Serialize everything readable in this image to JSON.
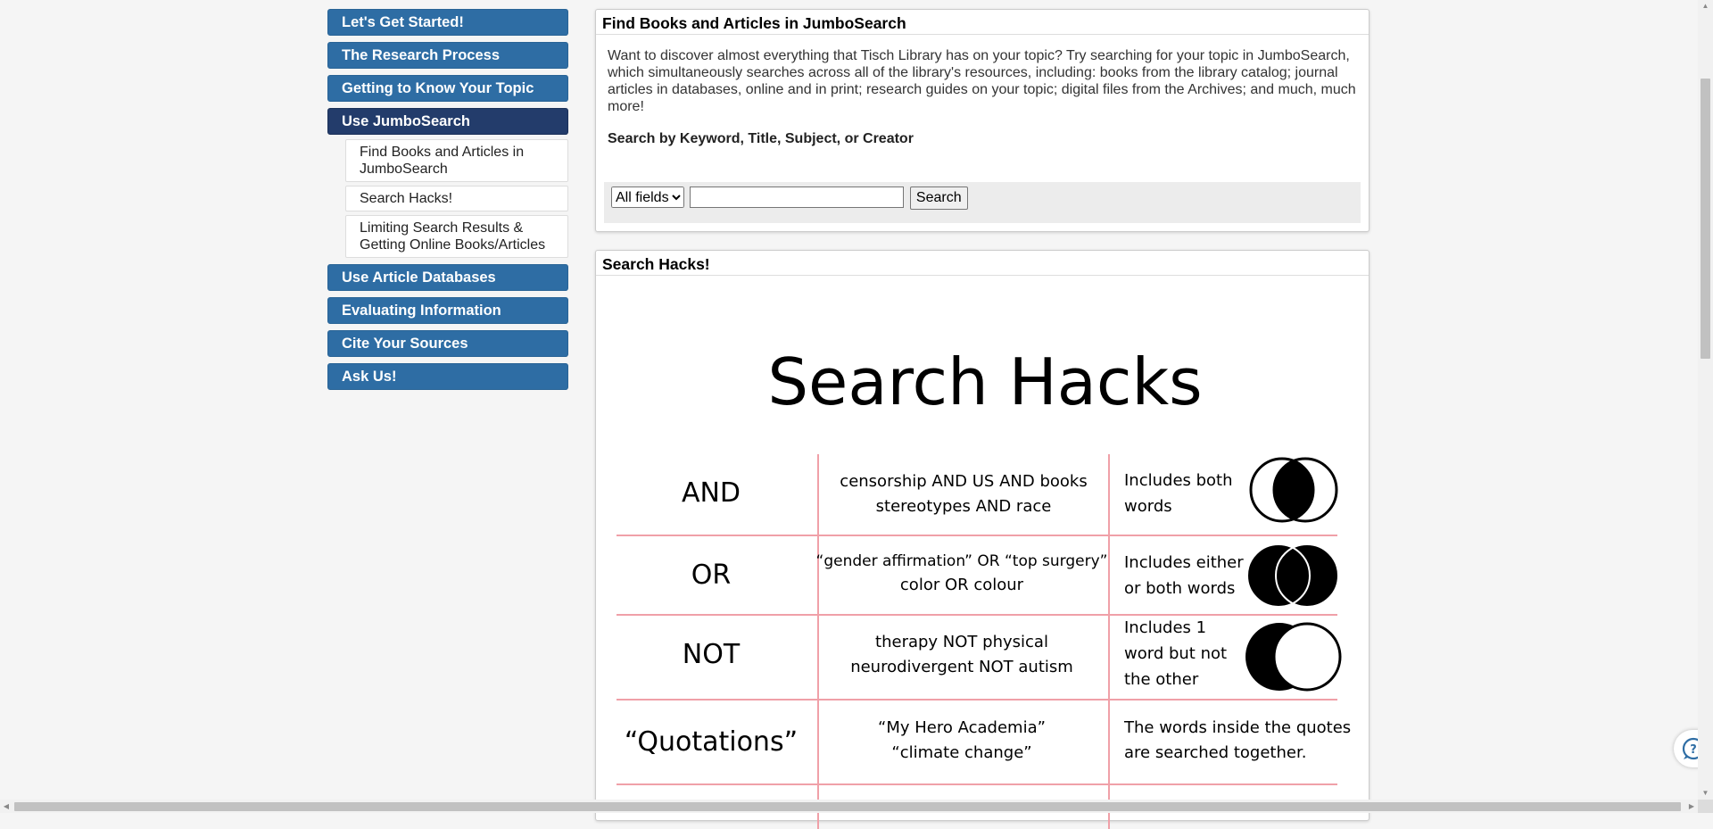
{
  "sidebar": {
    "items": [
      {
        "label": "Let's Get Started!"
      },
      {
        "label": "The Research Process"
      },
      {
        "label": "Getting to Know Your Topic"
      },
      {
        "label": "Use JumboSearch",
        "active": true
      },
      {
        "label": "Use Article Databases"
      },
      {
        "label": "Evaluating Information"
      },
      {
        "label": "Cite Your Sources"
      },
      {
        "label": "Ask Us!"
      }
    ],
    "subitems": [
      {
        "label": "Find Books and Articles in JumboSearch"
      },
      {
        "label": "Search Hacks!"
      },
      {
        "label": "Limiting Search Results & Getting Online Books/Articles"
      }
    ]
  },
  "box1": {
    "title": "Find Books and Articles in JumboSearch",
    "description": "Want to discover almost everything that Tisch Library has on your topic?  Try searching for your topic in JumboSearch, which simultaneously searches across all of the library's resources, including: books from the library catalog; journal articles in databases, online and in print; research guides on your topic; digital files from the Archives; and much, much more!",
    "search_label": "Search by Keyword, Title, Subject, or Creator",
    "search": {
      "field_selected": "All fields",
      "query_value": "",
      "button_label": "Search"
    }
  },
  "box2": {
    "title": "Search Hacks!",
    "graphic": {
      "heading": "Search Hacks",
      "rows": [
        {
          "operator": "AND",
          "example_1": "censorship AND US AND books",
          "example_2": "stereotypes AND race",
          "explanation_1": "Includes both",
          "explanation_2": "words",
          "explanation_3": "",
          "venn": "and"
        },
        {
          "operator": "OR",
          "example_1": "“gender affirmation” OR “top surgery”",
          "example_2": "color OR colour",
          "explanation_1": "Includes either",
          "explanation_2": "or both words",
          "explanation_3": "",
          "venn": "or"
        },
        {
          "operator": "NOT",
          "example_1": "therapy NOT physical",
          "example_2": "neurodivergent NOT autism",
          "explanation_1": "Includes 1",
          "explanation_2": "word but not",
          "explanation_3": "the other",
          "venn": "not"
        },
        {
          "operator": "“Quotations”",
          "example_1": "“My Hero Academia”",
          "example_2": "“climate change”",
          "explanation_1": "The words inside the quotes",
          "explanation_2": "are searched together.",
          "explanation_3": "",
          "venn": "none"
        }
      ],
      "line_color": "#f0a0a8"
    }
  },
  "chat": {
    "icon": "chat-help-icon"
  },
  "colors": {
    "nav_blue": "#2e6da4",
    "nav_active": "#233c6b"
  }
}
